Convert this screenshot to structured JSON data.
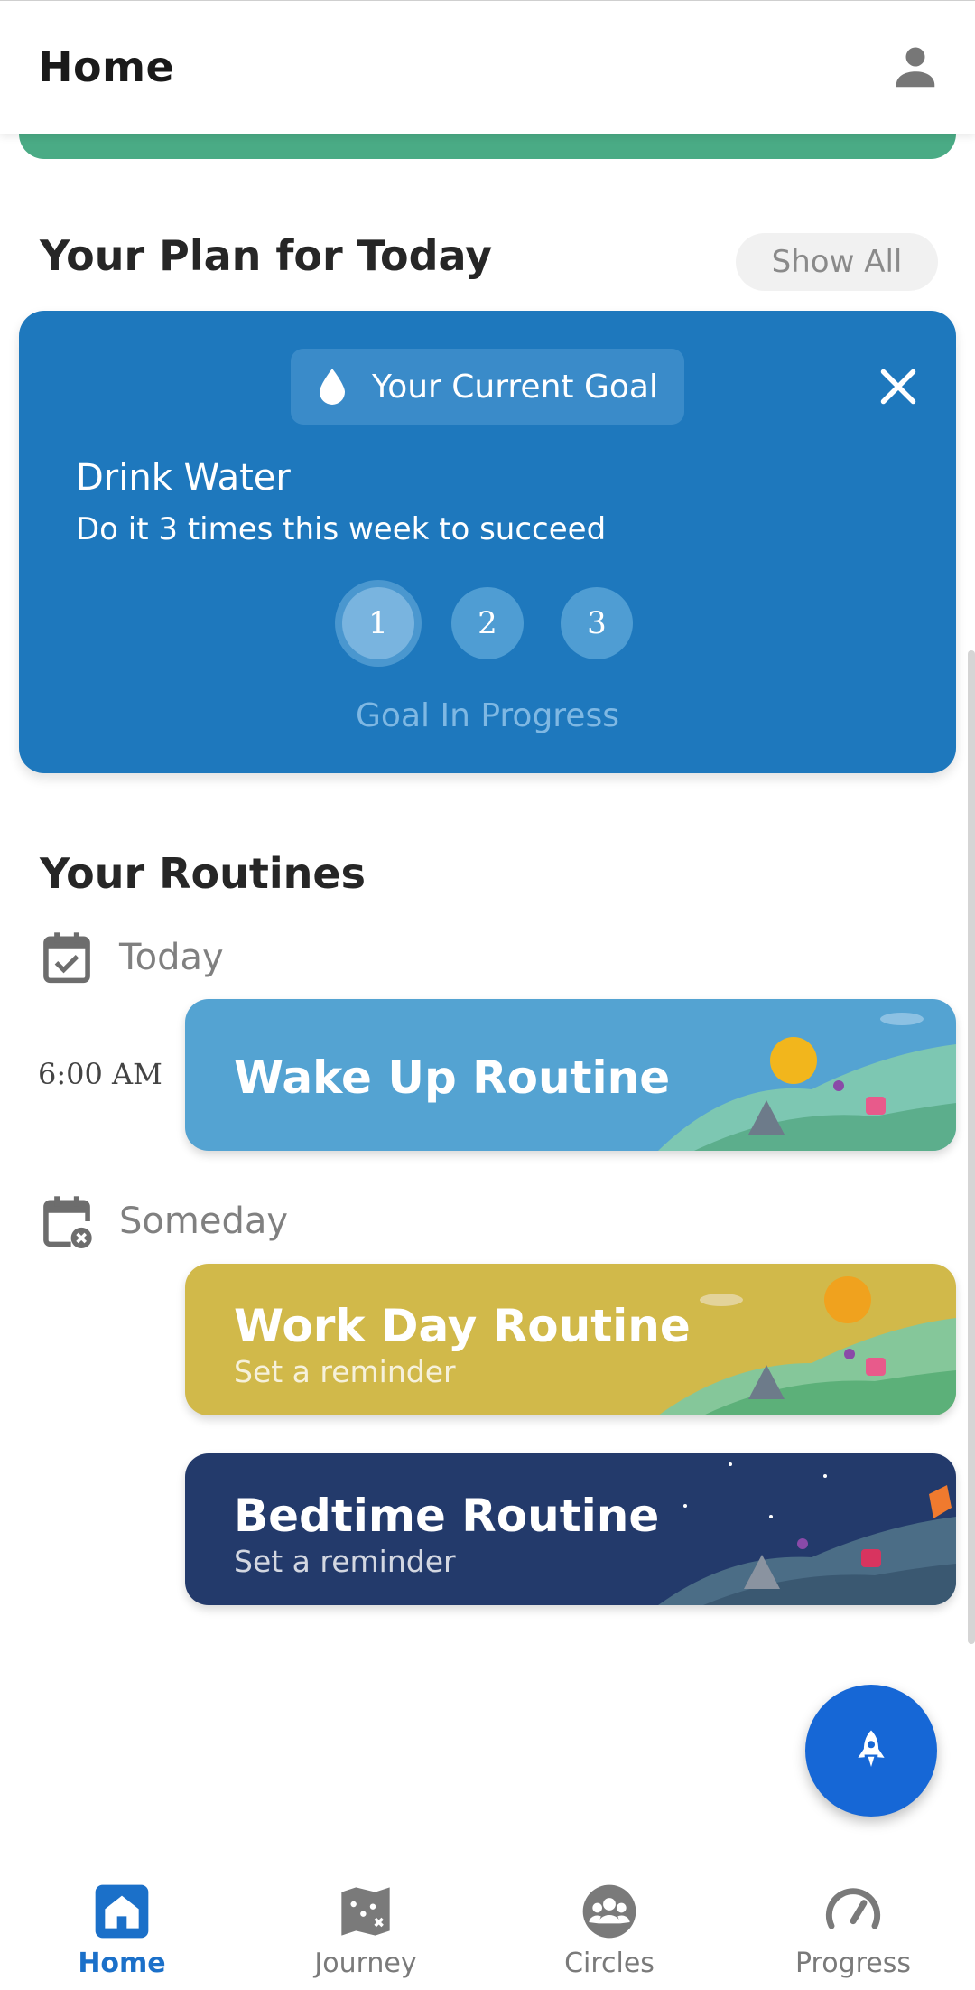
{
  "header": {
    "title": "Home",
    "profile_icon": "person-icon"
  },
  "plan": {
    "section_title": "Your Plan for Today",
    "show_all_label": "Show All",
    "goal": {
      "badge_label": "Your Current Goal",
      "name": "Drink Water",
      "description": "Do it 3 times this week to succeed",
      "steps": [
        "1",
        "2",
        "3"
      ],
      "status": "Goal In Progress"
    }
  },
  "routines": {
    "section_title": "Your Routines",
    "today_label": "Today",
    "someday_label": "Someday",
    "items": [
      {
        "time": "6:00 AM",
        "title": "Wake Up Routine",
        "subtitle": "",
        "color": "#54a3d2"
      },
      {
        "title": "Work Day Routine",
        "subtitle": "Set a reminder",
        "color": "#d1b94a"
      },
      {
        "title": "Bedtime Routine",
        "subtitle": "Set a reminder",
        "color": "#233a6b"
      }
    ]
  },
  "nav": {
    "items": [
      {
        "label": "Home",
        "icon": "home-icon",
        "active": true
      },
      {
        "label": "Journey",
        "icon": "map-icon",
        "active": false
      },
      {
        "label": "Circles",
        "icon": "group-icon",
        "active": false
      },
      {
        "label": "Progress",
        "icon": "gauge-icon",
        "active": false
      }
    ]
  },
  "colors": {
    "accent": "#1e78bd",
    "fab": "#1667d6",
    "active_nav": "#1b70c9"
  }
}
